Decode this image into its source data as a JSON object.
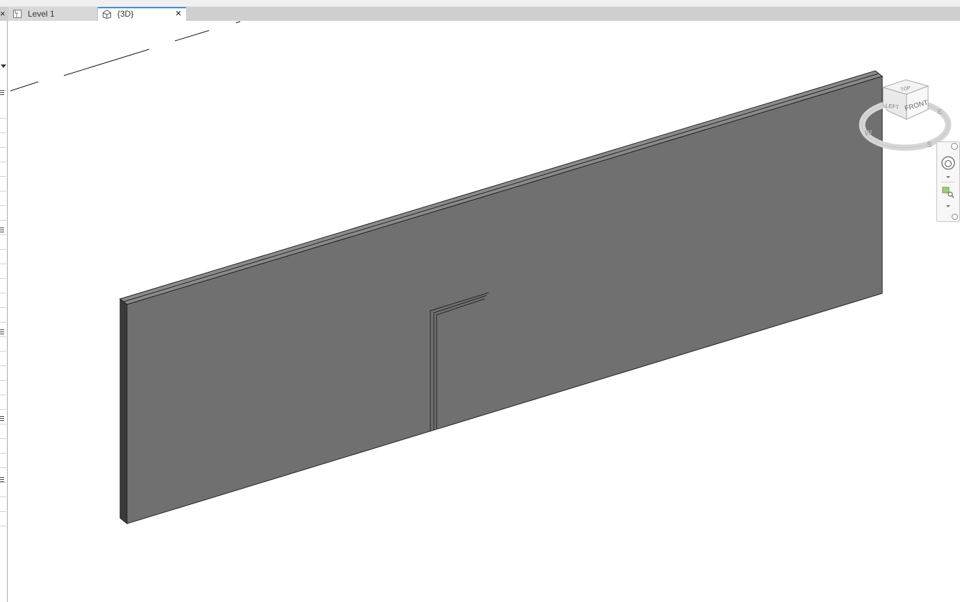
{
  "tabs": [
    {
      "label": "Level 1",
      "icon": "floor-plan-icon",
      "active": false
    },
    {
      "label": "{3D}",
      "icon": "3d-view-icon",
      "active": true
    }
  ],
  "close_glyph": "×",
  "viewcube": {
    "top_label": "TOP",
    "front_label": "FRONT",
    "left_label": "LEFT",
    "compass": {
      "west": "W",
      "south": "S",
      "east": "E"
    }
  },
  "colors": {
    "wall_face": "#707070",
    "wall_top": "#8a8a8a",
    "wall_end": "#3a3a3a",
    "active_tab_accent": "#3c8fd6"
  }
}
